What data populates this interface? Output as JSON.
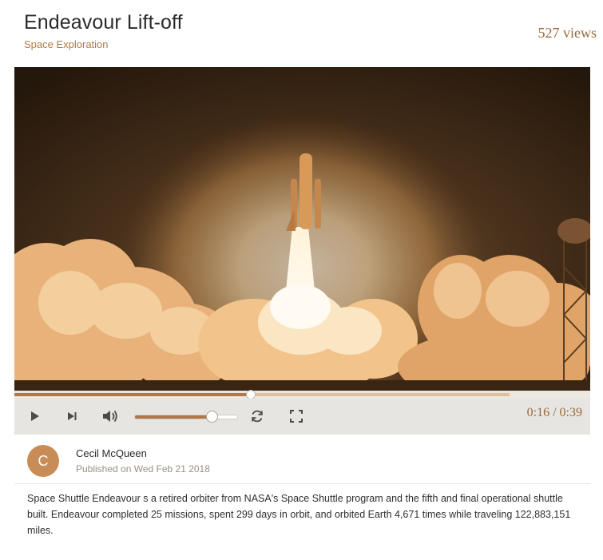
{
  "header": {
    "title": "Endeavour Lift-off",
    "category": "Space Exploration",
    "views": "527 views"
  },
  "video": {
    "thumbnail_icon": "shuttle-launch-image",
    "progress_fraction": 0.41,
    "buffered_fraction": 0.86
  },
  "controls": {
    "play_icon": "play-icon",
    "next_icon": "skip-next-icon",
    "volume_icon": "volume-icon",
    "volume_fraction": 0.76,
    "loop_icon": "loop-icon",
    "fullscreen_icon": "fullscreen-icon",
    "time": "0:16 / 0:39"
  },
  "author": {
    "initial": "C",
    "name": "Cecil McQueen",
    "published": "Published on Wed Feb 21 2018"
  },
  "description": "Space Shuttle Endeavour s a retired orbiter from NASA's Space Shuttle program and the fifth and final operational shuttle built. Endeavour completed 25 missions, spent 299 days in orbit, and orbited Earth 4,671 times while traveling 122,883,151 miles.",
  "colors": {
    "accent": "#b0784a",
    "avatar": "#c88d57",
    "controls_bg": "#e7e5e1"
  }
}
